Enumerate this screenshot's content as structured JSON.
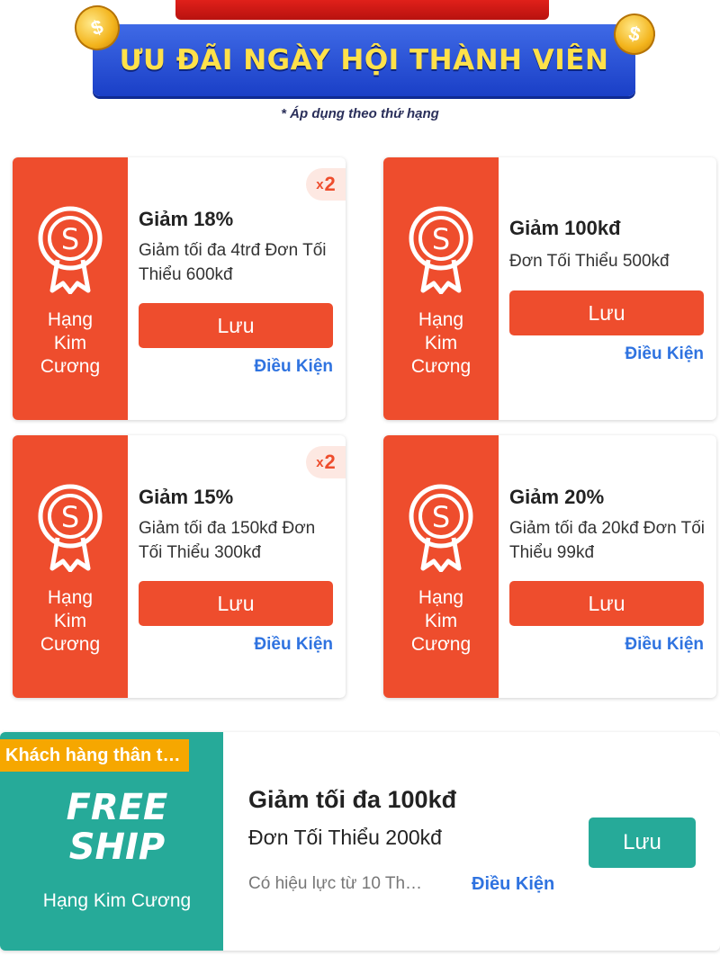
{
  "banner": {
    "title": "ƯU ĐÃI NGÀY HỘI THÀNH VIÊN",
    "note": "*  Áp dụng theo thứ hạng",
    "coin_symbol": "$"
  },
  "colors": {
    "shopee_orange": "#ee4d2d",
    "teal": "#26aa99",
    "link_blue": "#2f73e0",
    "banner_blue": "#1a3fc7",
    "banner_yellow": "#ffe14a",
    "tag_gold": "#f6a700"
  },
  "vouchers": [
    {
      "rank_line1": "Hạng",
      "rank_line2": "Kim",
      "rank_line3": "Cương",
      "icon": "shopee-medal-icon",
      "title": "Giảm 18%",
      "desc": "Giảm tối đa 4trđ Đơn Tối Thiểu 600kđ",
      "button": "Lưu",
      "link": "Điều Kiện",
      "qty_prefix": "x",
      "qty": "2"
    },
    {
      "rank_line1": "Hạng",
      "rank_line2": "Kim",
      "rank_line3": "Cương",
      "icon": "shopee-medal-icon",
      "title": "Giảm 100kđ",
      "desc": "Đơn Tối Thiểu 500kđ",
      "button": "Lưu",
      "link": "Điều Kiện"
    },
    {
      "rank_line1": "Hạng",
      "rank_line2": "Kim",
      "rank_line3": "Cương",
      "icon": "shopee-medal-icon",
      "title": "Giảm 15%",
      "desc": "Giảm tối đa 150kđ Đơn Tối Thiểu 300kđ",
      "button": "Lưu",
      "link": "Điều Kiện",
      "qty_prefix": "x",
      "qty": "2"
    },
    {
      "rank_line1": "Hạng",
      "rank_line2": "Kim",
      "rank_line3": "Cương",
      "icon": "shopee-medal-icon",
      "title": "Giảm 20%",
      "desc": "Giảm tối đa 20kđ Đơn Tối Thiểu 99kđ",
      "button": "Lưu",
      "link": "Điều Kiện"
    }
  ],
  "freeship": {
    "tag": "Khách hàng thân t…",
    "free_line1": "FREE",
    "free_line2": "SHIP",
    "rank": "Hạng Kim Cương",
    "title": "Giảm tối đa 100kđ",
    "desc": "Đơn Tối Thiểu 200kđ",
    "valid": "Có hiệu lực từ 10 Th…",
    "link": "Điều Kiện",
    "button": "Lưu"
  }
}
